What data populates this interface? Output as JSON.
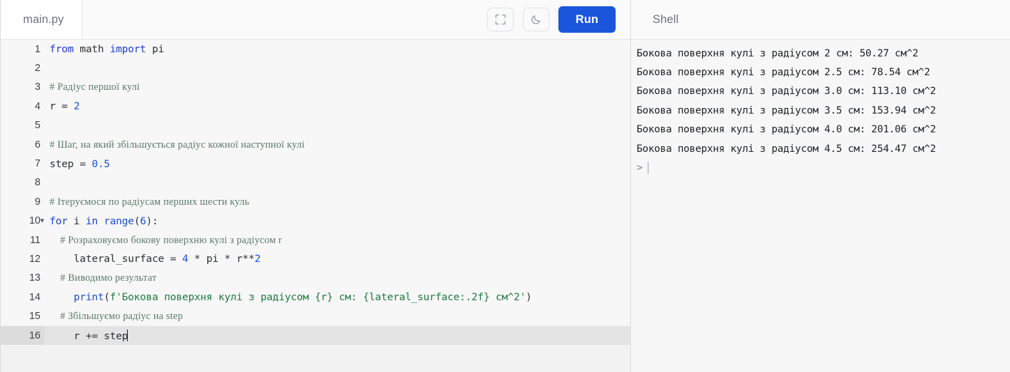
{
  "editor": {
    "tab": {
      "label": "main.py"
    },
    "toolbar": {
      "fullscreen_icon": "fullscreen-expand-icon",
      "theme_icon": "moon-dark-mode-icon",
      "run_label": "Run",
      "run_color": "#1a56db"
    },
    "active_line": 16,
    "lines": [
      {
        "n": "1",
        "tokens": [
          {
            "t": "from ",
            "c": "kw"
          },
          {
            "t": "math ",
            "c": "id"
          },
          {
            "t": "import ",
            "c": "kw"
          },
          {
            "t": "pi",
            "c": "id"
          }
        ]
      },
      {
        "n": "2",
        "tokens": []
      },
      {
        "n": "3",
        "tokens": [
          {
            "t": "# Радіус першої кулі",
            "c": "cmt"
          }
        ]
      },
      {
        "n": "4",
        "tokens": [
          {
            "t": "r ",
            "c": "id"
          },
          {
            "t": "= ",
            "c": "op"
          },
          {
            "t": "2",
            "c": "num2"
          }
        ]
      },
      {
        "n": "5",
        "tokens": []
      },
      {
        "n": "6",
        "tokens": [
          {
            "t": "# Шаг, на який збільшується радіус кожної наступної кулі",
            "c": "cmt"
          }
        ]
      },
      {
        "n": "7",
        "tokens": [
          {
            "t": "step ",
            "c": "id"
          },
          {
            "t": "= ",
            "c": "op"
          },
          {
            "t": "0.5",
            "c": "num2"
          }
        ]
      },
      {
        "n": "8",
        "tokens": []
      },
      {
        "n": "9",
        "tokens": [
          {
            "t": "# Ітеруємося по радіусам перших шести куль",
            "c": "cmt"
          }
        ]
      },
      {
        "n": "10",
        "fold": true,
        "tokens": [
          {
            "t": "for ",
            "c": "kw"
          },
          {
            "t": "i ",
            "c": "id"
          },
          {
            "t": "in ",
            "c": "kw"
          },
          {
            "t": "range",
            "c": "bi"
          },
          {
            "t": "(",
            "c": "op"
          },
          {
            "t": "6",
            "c": "num2"
          },
          {
            "t": "):",
            "c": "op"
          }
        ]
      },
      {
        "n": "11",
        "tokens": [
          {
            "t": "    # Розраховуємо бокову поверхню кулі з радіусом r",
            "c": "cmt"
          }
        ]
      },
      {
        "n": "12",
        "tokens": [
          {
            "t": "    lateral_surface ",
            "c": "id"
          },
          {
            "t": "= ",
            "c": "op"
          },
          {
            "t": "4",
            "c": "num2"
          },
          {
            "t": " * ",
            "c": "op"
          },
          {
            "t": "pi",
            "c": "id"
          },
          {
            "t": " * ",
            "c": "op"
          },
          {
            "t": "r",
            "c": "id"
          },
          {
            "t": "**",
            "c": "op"
          },
          {
            "t": "2",
            "c": "num2"
          }
        ]
      },
      {
        "n": "13",
        "tokens": [
          {
            "t": "    # Виводимо результат",
            "c": "cmt"
          }
        ]
      },
      {
        "n": "14",
        "tokens": [
          {
            "t": "    print",
            "c": "bi"
          },
          {
            "t": "(",
            "c": "op"
          },
          {
            "t": "f'Бокова поверхня кулі з радіусом {r} см: {lateral_surface:.2f} см^2'",
            "c": "str"
          },
          {
            "t": ")",
            "c": "op"
          }
        ]
      },
      {
        "n": "15",
        "tokens": [
          {
            "t": "    # Збільшуємо радіус на step",
            "c": "cmt"
          }
        ]
      },
      {
        "n": "16",
        "tokens": [
          {
            "t": "    r ",
            "c": "id"
          },
          {
            "t": "+= ",
            "c": "op"
          },
          {
            "t": "step",
            "c": "id"
          }
        ],
        "caret": true
      }
    ]
  },
  "shell": {
    "title": "Shell",
    "output": [
      "Бокова поверхня кулі з радіусом 2 см: 50.27 см^2",
      "Бокова поверхня кулі з радіусом 2.5 см: 78.54 см^2",
      "Бокова поверхня кулі з радіусом 3.0 см: 113.10 см^2",
      "Бокова поверхня кулі з радіусом 3.5 см: 153.94 см^2",
      "Бокова поверхня кулі з радіусом 4.0 см: 201.06 см^2",
      "Бокова поверхня кулі з радіусом 4.5 см: 254.47 см^2"
    ],
    "prompt_symbol": ">",
    "prompt_value": ""
  }
}
